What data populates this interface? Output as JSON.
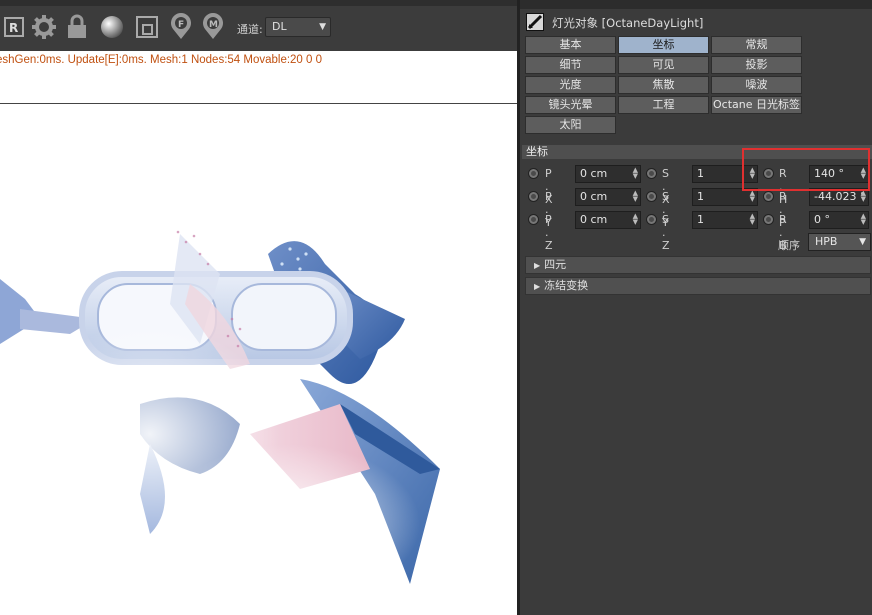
{
  "viewer": {
    "channel_label": "通道:",
    "channel_value": "DL",
    "stats_text": "eshGen:0ms. Update[E]:0ms. Mesh:1 Nodes:54 Movable:20  0 0",
    "toolbar_icons": [
      "render-region-icon",
      "settings-gear-icon",
      "lock-icon",
      "material-sphere-icon",
      "viewport-icon",
      "focus-pin-icon",
      "material-pin-icon"
    ],
    "colors": {
      "stats": "#c05010",
      "toolbar": "#3c3c3c"
    }
  },
  "attr": {
    "title": "灯光对象 [OctaneDayLight]",
    "tabs": [
      {
        "label": "基本",
        "active": false
      },
      {
        "label": "坐标",
        "active": true
      },
      {
        "label": "常规",
        "active": false
      },
      {
        "label": "细节",
        "active": false
      },
      {
        "label": "可见",
        "active": false
      },
      {
        "label": "投影",
        "active": false
      },
      {
        "label": "光度",
        "active": false
      },
      {
        "label": "焦散",
        "active": false
      },
      {
        "label": "噪波",
        "active": false
      },
      {
        "label": "镜头光晕",
        "active": false
      },
      {
        "label": "工程",
        "active": false
      },
      {
        "label": "Octane 日光标签",
        "active": false
      },
      {
        "label": "太阳",
        "active": false
      }
    ],
    "section_title": "坐标",
    "coords": {
      "px_label": "P . X",
      "px_value": "0 cm",
      "py_label": "P . Y",
      "py_value": "0 cm",
      "pz_label": "P . Z",
      "pz_value": "0 cm",
      "sx_label": "S . X",
      "sx_value": "1",
      "sy_label": "S . Y",
      "sy_value": "1",
      "sz_label": "S . Z",
      "sz_value": "1",
      "rh_label": "R . H",
      "rh_value": "140 °",
      "rp_label": "R . P",
      "rp_value": "-44.023 °",
      "rb_label": "R . B",
      "rb_value": "0 °"
    },
    "order_label": "顺序",
    "order_value": "HPB",
    "quaternion_label": "四元",
    "freeze_label": "冻结变换",
    "colors": {
      "active_tab": "#9fb3cc",
      "highlight": "#e03030"
    }
  }
}
